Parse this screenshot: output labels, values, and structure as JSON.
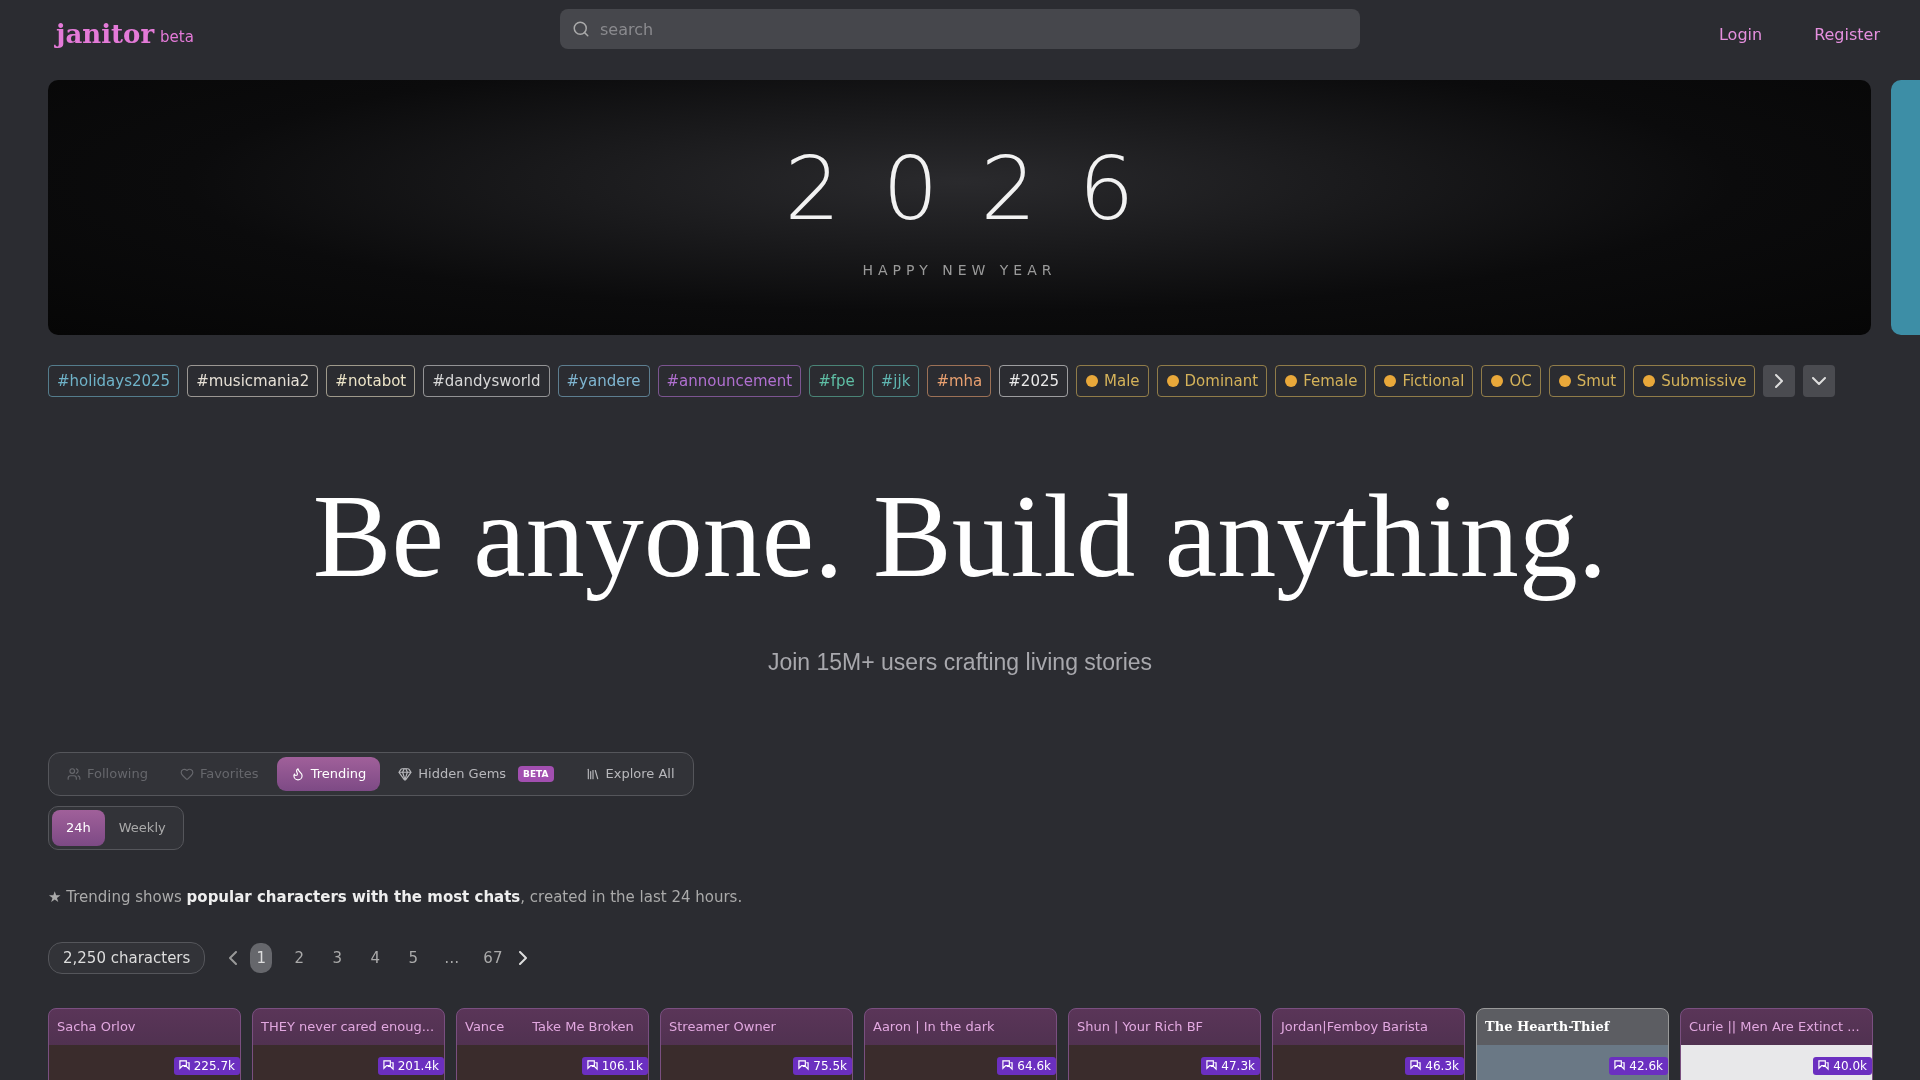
{
  "header": {
    "logo": "janitor",
    "logo_badge": "beta",
    "search": {
      "placeholder": "search"
    },
    "links": [
      "Login",
      "Register"
    ]
  },
  "banner": {
    "year": "2026",
    "caption": "HAPPY NEW YEAR"
  },
  "tags": [
    {
      "label": "#holidays2025",
      "color": "#6fb3c9",
      "icon": false
    },
    {
      "label": "#musicmania2",
      "color": "#e6e0d6",
      "icon": false
    },
    {
      "label": "#notabot",
      "color": "#ece4c8",
      "icon": false
    },
    {
      "label": "#dandysworld",
      "color": "#d8d8d8",
      "icon": false
    },
    {
      "label": "#yandere",
      "color": "#7fb5d0",
      "icon": false
    },
    {
      "label": "#announcement",
      "color": "#b070d0",
      "icon": false
    },
    {
      "label": "#fpe",
      "color": "#5fbfa5",
      "icon": false
    },
    {
      "label": "#jjk",
      "color": "#5fb5b0",
      "icon": false
    },
    {
      "label": "#mha",
      "color": "#e8a070",
      "icon": false
    },
    {
      "label": "#2025",
      "color": "#eaeaea",
      "icon": false
    },
    {
      "label": "Male",
      "color": "#d4b25a",
      "icon": true
    },
    {
      "label": "Dominant",
      "color": "#d4b25a",
      "icon": true
    },
    {
      "label": "Female",
      "color": "#d4b25a",
      "icon": true
    },
    {
      "label": "Fictional",
      "color": "#d4b25a",
      "icon": true
    },
    {
      "label": "OC",
      "color": "#d4b25a",
      "icon": true
    },
    {
      "label": "Smut",
      "color": "#d4b25a",
      "icon": true
    },
    {
      "label": "Submissive",
      "color": "#d4b25a",
      "icon": true
    }
  ],
  "hero": {
    "title": "Be anyone. Build anything.",
    "subtitle": "Join 15M+ users crafting living stories"
  },
  "tabs": [
    {
      "label": "Following",
      "selected": false,
      "disabled": true
    },
    {
      "label": "Favorites",
      "selected": false,
      "disabled": true
    },
    {
      "label": "Trending",
      "selected": true,
      "disabled": false
    },
    {
      "label": "Hidden Gems",
      "selected": false,
      "disabled": false,
      "badge": "BETA"
    },
    {
      "label": "Explore All",
      "selected": false,
      "disabled": false
    }
  ],
  "periods": [
    {
      "label": "24h",
      "selected": true
    },
    {
      "label": "Weekly",
      "selected": false
    }
  ],
  "note": "★ Trending shows **popular characters with the most chats**, created in the last 24 hours.",
  "count": "2,250 characters",
  "pages": [
    {
      "label": "1",
      "selected": true
    },
    {
      "label": "2",
      "selected": false
    },
    {
      "label": "3",
      "selected": false
    },
    {
      "label": "4",
      "selected": false
    },
    {
      "label": "5",
      "selected": false
    },
    {
      "label": "…",
      "selected": false
    },
    {
      "label": "67",
      "selected": false
    }
  ],
  "cards": [
    {
      "kind": "plain",
      "title": "Sacha Orlov",
      "chats": "225.7k"
    },
    {
      "kind": "plain",
      "title": "THEY never cared enoug...",
      "chats": "201.4k"
    },
    {
      "kind": "plain",
      "title": "Vance",
      "subtitle": "Take Me Broken",
      "chats": "106.1k"
    },
    {
      "kind": "plain",
      "title": "Streamer Owner",
      "chats": "75.5k"
    },
    {
      "kind": "plain",
      "title": "Aaron | In the dark",
      "chats": "64.6k"
    },
    {
      "kind": "plain",
      "title": "Shun | Your Rich BF",
      "chats": "47.3k"
    },
    {
      "kind": "plain",
      "title": "Jordan|Femboy Barista",
      "chats": "46.3k"
    },
    {
      "kind": "styled",
      "title": "The Hearth-Thief",
      "chats": "42.6k"
    },
    {
      "kind": "light",
      "title": "Curie || Men Are Extinct ...",
      "chats": "40.0k"
    }
  ]
}
